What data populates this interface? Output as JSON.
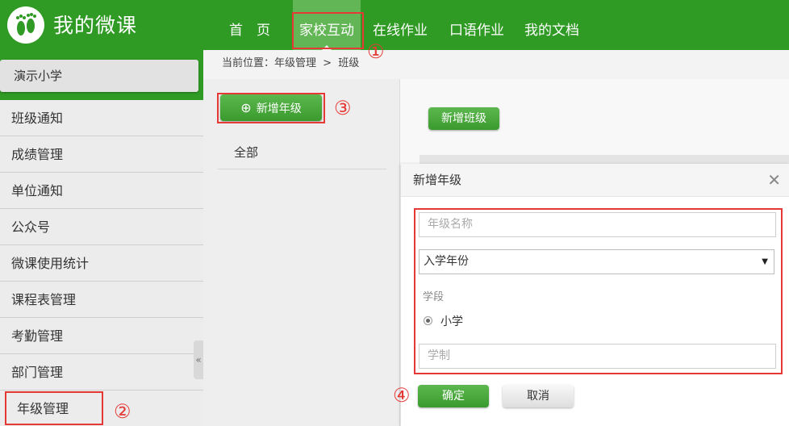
{
  "header": {
    "app_title": "我的微课",
    "nav": [
      {
        "label": "首　页"
      },
      {
        "label": "家校互动"
      },
      {
        "label": "在线作业"
      },
      {
        "label": "口语作业"
      },
      {
        "label": "我的文档"
      }
    ],
    "active_nav": "家校互动",
    "brand_color": "#2f9a24"
  },
  "sidebar": {
    "school_name": "演示小学",
    "items": [
      {
        "label": "班级通知"
      },
      {
        "label": "成绩管理"
      },
      {
        "label": "单位通知"
      },
      {
        "label": "公众号"
      },
      {
        "label": "微课使用统计"
      },
      {
        "label": "课程表管理"
      },
      {
        "label": "考勤管理"
      },
      {
        "label": "部门管理"
      },
      {
        "label": "年级管理"
      }
    ],
    "collapse_icon": "«"
  },
  "breadcrumb": {
    "prefix": "当前位置：",
    "path": [
      "年级管理",
      "班级"
    ],
    "separator": ">"
  },
  "grade_panel": {
    "add_grade_label": "新增年级",
    "add_icon": "⊕",
    "all_label": "全部"
  },
  "class_panel": {
    "add_class_label": "新增班级"
  },
  "modal": {
    "title": "新增年级",
    "close_icon": "✕",
    "grade_name_placeholder": "年级名称",
    "enroll_year_selected": "入学年份",
    "stage_label": "学段",
    "stage_option": "小学",
    "duration_placeholder": "学制",
    "confirm_label": "确定",
    "cancel_label": "取消"
  },
  "annotations": {
    "n1": "①",
    "n2": "②",
    "n3": "③",
    "n4": "④",
    "color": "#e53935"
  }
}
